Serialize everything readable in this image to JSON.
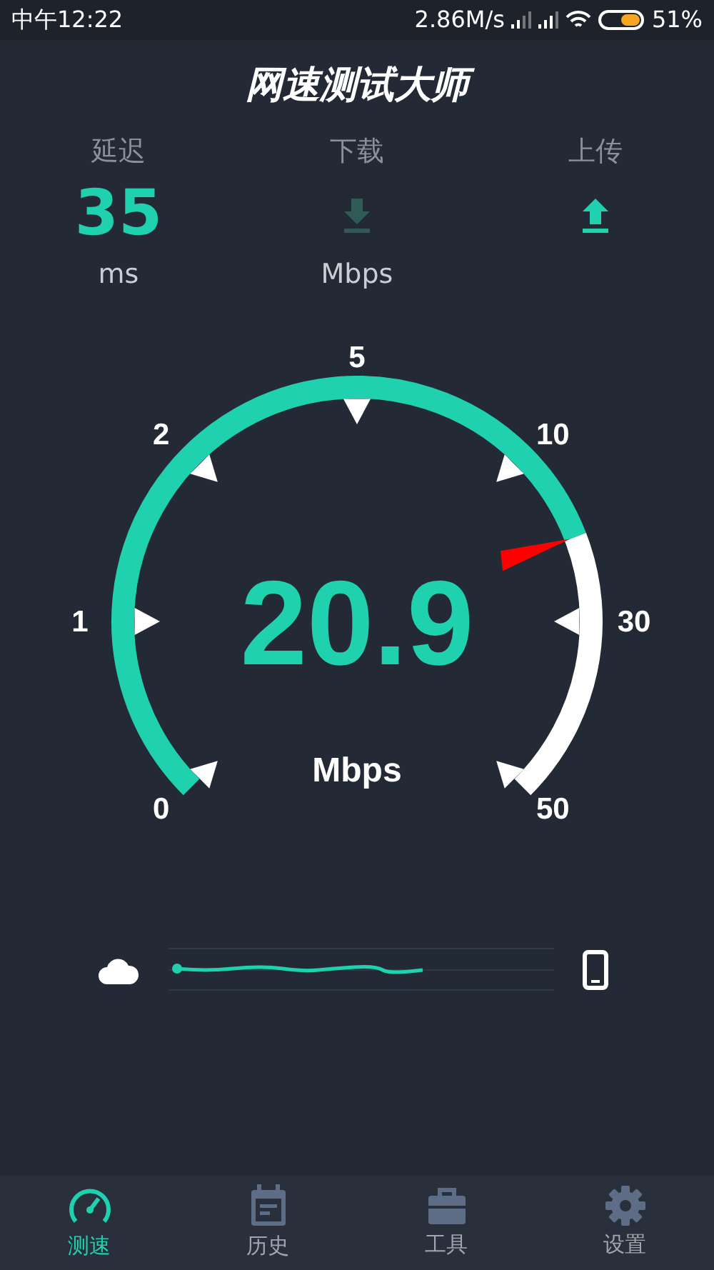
{
  "status_bar": {
    "time": "中午12:22",
    "net_speed": "2.86M/s",
    "battery": "51%"
  },
  "title": "网速测试大师",
  "metrics": [
    {
      "kind": "value",
      "label": "延迟",
      "value": "35",
      "unit": "ms"
    },
    {
      "kind": "icon",
      "label": "下载",
      "active": false,
      "unit": "Mbps"
    },
    {
      "kind": "icon",
      "label": "上传",
      "active": true
    }
  ],
  "gauge": {
    "reading": "20.9",
    "unit": "Mbps",
    "ticks": [
      "0",
      "1",
      "2",
      "5",
      "10",
      "30",
      "50"
    ]
  },
  "tabs": [
    {
      "label": "测速",
      "selected": true
    },
    {
      "label": "历史",
      "selected": false
    },
    {
      "label": "工具",
      "selected": false
    },
    {
      "label": "设置",
      "selected": false
    }
  ]
}
